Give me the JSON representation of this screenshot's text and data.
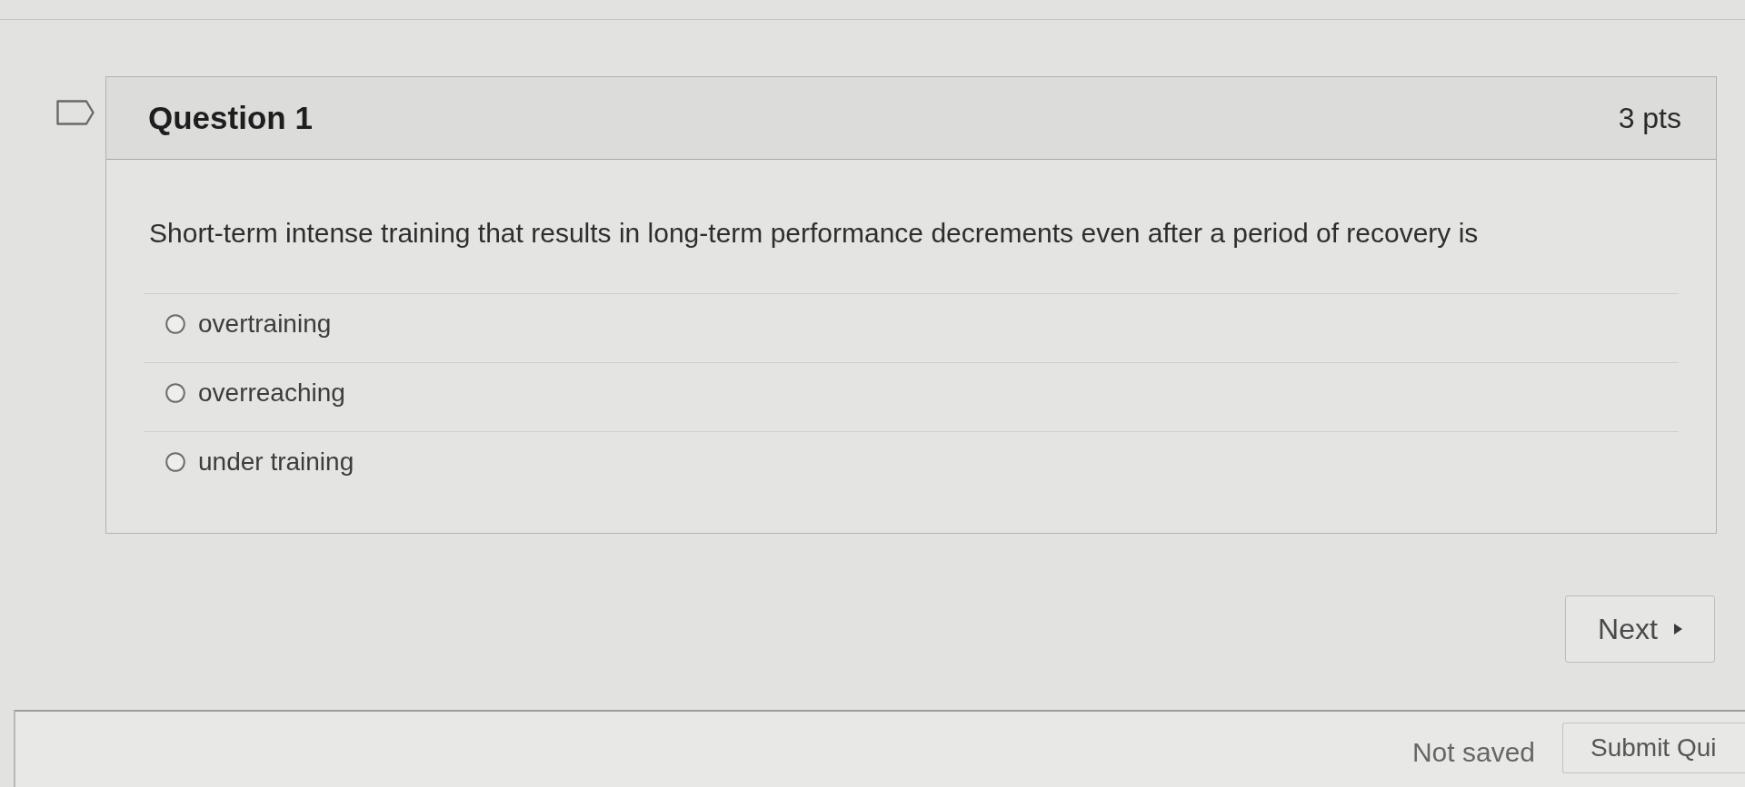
{
  "quiz_nav": {
    "flagged": false
  },
  "question": {
    "title": "Question 1",
    "points": "3 pts",
    "text": "Short-term intense training that results in long-term performance decrements even after a period of recovery is",
    "answers": [
      {
        "label": "overtraining",
        "selected": false
      },
      {
        "label": "overreaching",
        "selected": false
      },
      {
        "label": "under training",
        "selected": false
      }
    ]
  },
  "next_button": {
    "label": "Next"
  },
  "footer": {
    "status": "Not saved",
    "submit_button": "Submit Qui"
  }
}
